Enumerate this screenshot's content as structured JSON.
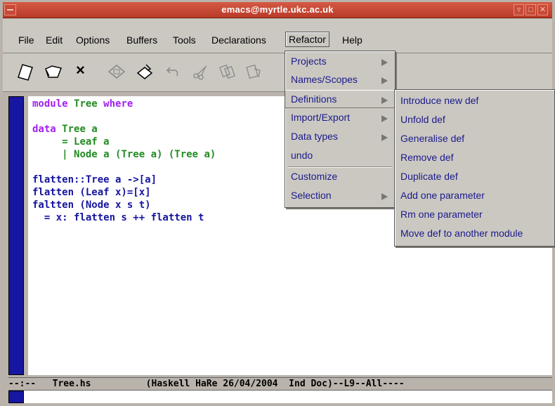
{
  "window": {
    "title": "emacs@myrtle.ukc.ac.uk"
  },
  "menubar": {
    "items": [
      "File",
      "Edit",
      "Options",
      "Buffers",
      "Tools",
      "Declarations",
      "Refactor",
      "Help"
    ]
  },
  "toolbar": {
    "icons": [
      "open-file-icon",
      "open-directory-icon",
      "close-icon",
      "save-icon",
      "print-icon",
      "undo-icon",
      "cut-icon",
      "copy-icon",
      "paste-icon"
    ],
    "close_glyph": "×"
  },
  "refactor_menu": {
    "items": [
      {
        "label": "Projects",
        "submenu": true
      },
      {
        "label": "Names/Scopes",
        "submenu": true
      },
      {
        "label": "Definitions",
        "submenu": true
      },
      {
        "label": "Import/Export",
        "submenu": true
      },
      {
        "label": "Data types",
        "submenu": true
      },
      {
        "label": "undo",
        "submenu": false
      },
      {
        "label": "Customize",
        "submenu": false
      },
      {
        "label": "Selection",
        "submenu": true
      }
    ]
  },
  "definitions_submenu": {
    "items": [
      "Introduce new def",
      "Unfold def",
      "Generalise def",
      "Remove def",
      "Duplicate def",
      "Add one parameter",
      "Rm one parameter",
      "Move def to another module"
    ]
  },
  "editor": {
    "line1_kw1": "module",
    "line1_ty": "Tree",
    "line1_kw2": "where",
    "line2_kw": "data",
    "line2_ty": "Tree a",
    "line3_pre": "     = ",
    "line3_ty": "Leaf a",
    "line4_pre": "     | ",
    "line4_ty": "Node a (Tree a) (Tree a)",
    "line5": "flatten::Tree a ->[a]",
    "line6": "flatten (Leaf x)=[x]",
    "line7": "faltten (Node x s t)",
    "line8": "  = x: flatten s ++ flatten t"
  },
  "modeline": {
    "text": "--:--   Tree.hs          (Haskell HaRe 26/04/2004  Ind Doc)--L9--All----"
  },
  "colors": {
    "titlebar": "#c84a36",
    "fringe": "#1616a0",
    "keyword": "#a020f0",
    "type": "#228b22",
    "code": "#1515a0"
  }
}
